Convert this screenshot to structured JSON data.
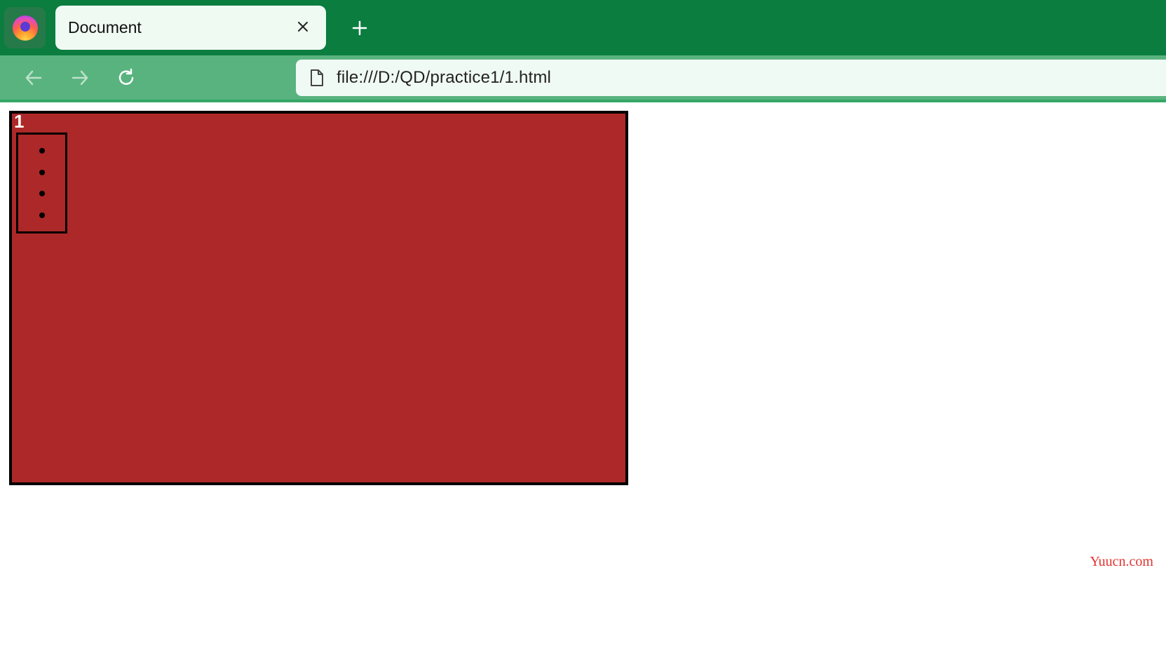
{
  "browser": {
    "tab_title": "Document",
    "url": "file:///D:/QD/practice1/1.html"
  },
  "page": {
    "box_number": "1",
    "list_items": [
      "",
      "",
      "",
      ""
    ]
  },
  "watermark": "Yuucn.com"
}
